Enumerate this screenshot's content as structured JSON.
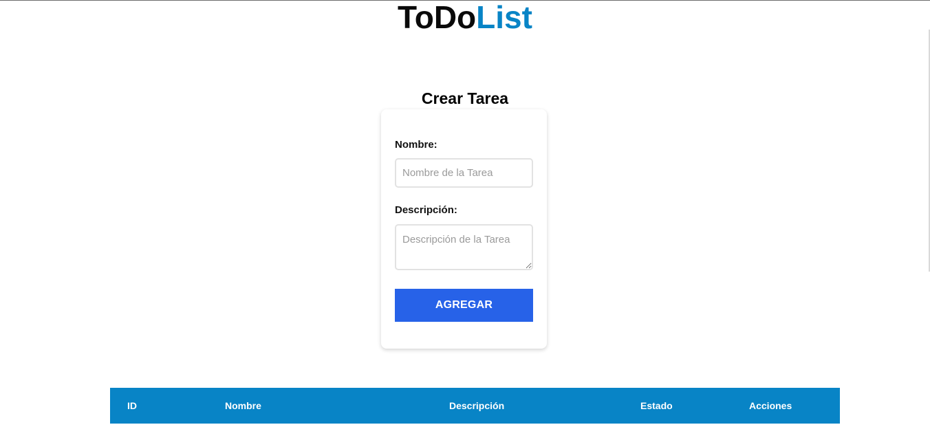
{
  "header": {
    "logo_part1": "ToDo",
    "logo_part2": "List"
  },
  "form": {
    "title": "Crear Tarea",
    "name_label": "Nombre:",
    "name_placeholder": "Nombre de la Tarea",
    "name_value": "",
    "description_label": "Descripción:",
    "description_placeholder": "Descripción de la Tarea",
    "description_value": "",
    "submit_label": "AGREGAR"
  },
  "table": {
    "columns": [
      "ID",
      "Nombre",
      "Descripción",
      "Estado",
      "Acciones"
    ],
    "rows": []
  },
  "colors": {
    "brand_blue": "#0884c6",
    "button_blue": "#2762e8"
  }
}
